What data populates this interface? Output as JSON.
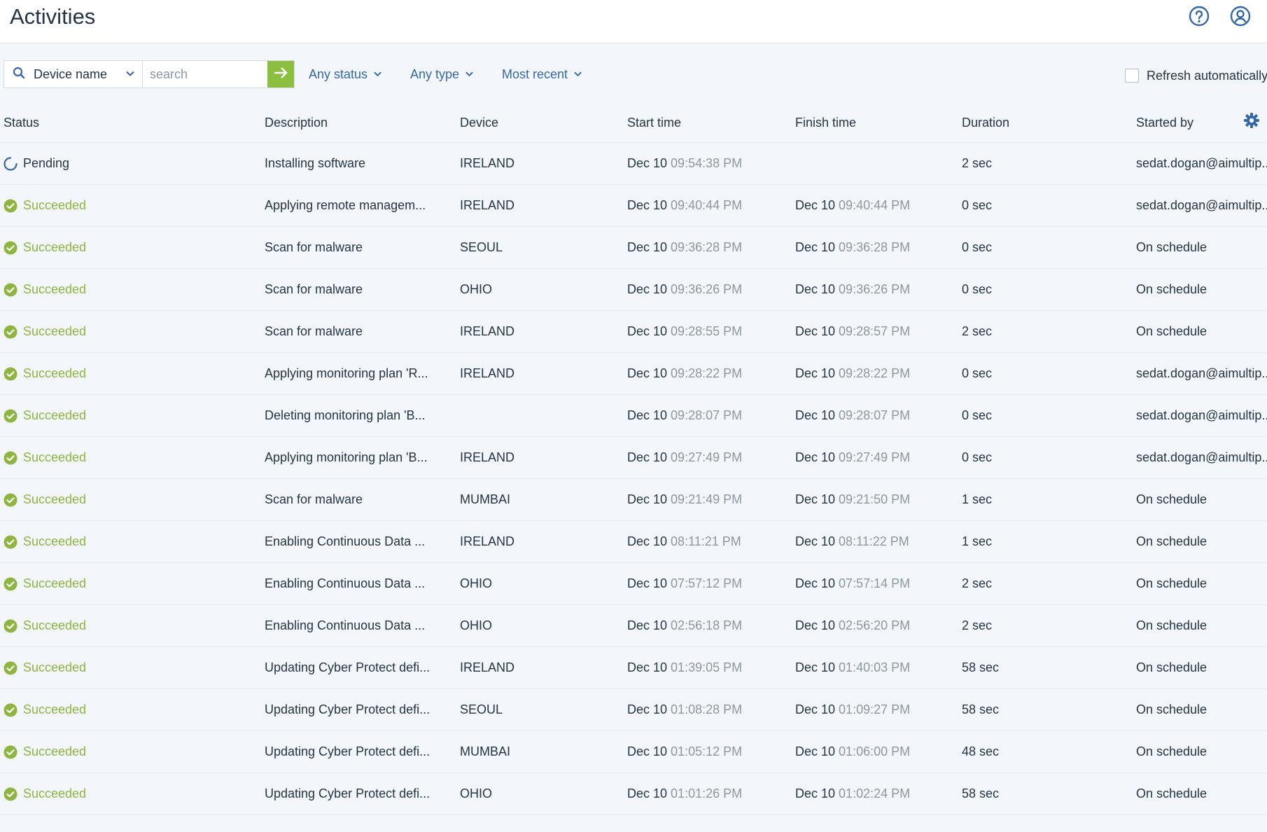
{
  "header": {
    "title": "Activities"
  },
  "toolbar": {
    "field_select_label": "Device name",
    "search_placeholder": "search",
    "status_filter": "Any status",
    "type_filter": "Any type",
    "sort_filter": "Most recent",
    "refresh_label": "Refresh automatically"
  },
  "columns": {
    "status": "Status",
    "description": "Description",
    "device": "Device",
    "start": "Start time",
    "finish": "Finish time",
    "duration": "Duration",
    "started_by": "Started by"
  },
  "colors": {
    "accent": "#3467a8",
    "success": "#8db53f",
    "go_button": "#8cbf3f"
  },
  "rows": [
    {
      "status": "Pending",
      "status_type": "pending",
      "description": "Installing software",
      "device": "IRELAND",
      "start_date": "Dec 10",
      "start_time": "09:54:38 PM",
      "finish_date": "",
      "finish_time": "",
      "duration": "2 sec",
      "started_by": "sedat.dogan@aimultip..."
    },
    {
      "status": "Succeeded",
      "status_type": "success",
      "description": "Applying remote managem...",
      "device": "IRELAND",
      "start_date": "Dec 10",
      "start_time": "09:40:44 PM",
      "finish_date": "Dec 10",
      "finish_time": "09:40:44 PM",
      "duration": "0 sec",
      "started_by": "sedat.dogan@aimultip..."
    },
    {
      "status": "Succeeded",
      "status_type": "success",
      "description": "Scan for malware",
      "device": "SEOUL",
      "start_date": "Dec 10",
      "start_time": "09:36:28 PM",
      "finish_date": "Dec 10",
      "finish_time": "09:36:28 PM",
      "duration": "0 sec",
      "started_by": "On schedule"
    },
    {
      "status": "Succeeded",
      "status_type": "success",
      "description": "Scan for malware",
      "device": "OHIO",
      "start_date": "Dec 10",
      "start_time": "09:36:26 PM",
      "finish_date": "Dec 10",
      "finish_time": "09:36:26 PM",
      "duration": "0 sec",
      "started_by": "On schedule"
    },
    {
      "status": "Succeeded",
      "status_type": "success",
      "description": "Scan for malware",
      "device": "IRELAND",
      "start_date": "Dec 10",
      "start_time": "09:28:55 PM",
      "finish_date": "Dec 10",
      "finish_time": "09:28:57 PM",
      "duration": "2 sec",
      "started_by": "On schedule"
    },
    {
      "status": "Succeeded",
      "status_type": "success",
      "description": "Applying monitoring plan 'R...",
      "device": "IRELAND",
      "start_date": "Dec 10",
      "start_time": "09:28:22 PM",
      "finish_date": "Dec 10",
      "finish_time": "09:28:22 PM",
      "duration": "0 sec",
      "started_by": "sedat.dogan@aimultip..."
    },
    {
      "status": "Succeeded",
      "status_type": "success",
      "description": "Deleting monitoring plan 'B...",
      "device": "",
      "start_date": "Dec 10",
      "start_time": "09:28:07 PM",
      "finish_date": "Dec 10",
      "finish_time": "09:28:07 PM",
      "duration": "0 sec",
      "started_by": "sedat.dogan@aimultip..."
    },
    {
      "status": "Succeeded",
      "status_type": "success",
      "description": "Applying monitoring plan 'B...",
      "device": "IRELAND",
      "start_date": "Dec 10",
      "start_time": "09:27:49 PM",
      "finish_date": "Dec 10",
      "finish_time": "09:27:49 PM",
      "duration": "0 sec",
      "started_by": "sedat.dogan@aimultip..."
    },
    {
      "status": "Succeeded",
      "status_type": "success",
      "description": "Scan for malware",
      "device": "MUMBAI",
      "start_date": "Dec 10",
      "start_time": "09:21:49 PM",
      "finish_date": "Dec 10",
      "finish_time": "09:21:50 PM",
      "duration": "1 sec",
      "started_by": "On schedule"
    },
    {
      "status": "Succeeded",
      "status_type": "success",
      "description": "Enabling Continuous Data ...",
      "device": "IRELAND",
      "start_date": "Dec 10",
      "start_time": "08:11:21 PM",
      "finish_date": "Dec 10",
      "finish_time": "08:11:22 PM",
      "duration": "1 sec",
      "started_by": "On schedule"
    },
    {
      "status": "Succeeded",
      "status_type": "success",
      "description": "Enabling Continuous Data ...",
      "device": "OHIO",
      "start_date": "Dec 10",
      "start_time": "07:57:12 PM",
      "finish_date": "Dec 10",
      "finish_time": "07:57:14 PM",
      "duration": "2 sec",
      "started_by": "On schedule"
    },
    {
      "status": "Succeeded",
      "status_type": "success",
      "description": "Enabling Continuous Data ...",
      "device": "OHIO",
      "start_date": "Dec 10",
      "start_time": "02:56:18 PM",
      "finish_date": "Dec 10",
      "finish_time": "02:56:20 PM",
      "duration": "2 sec",
      "started_by": "On schedule"
    },
    {
      "status": "Succeeded",
      "status_type": "success",
      "description": "Updating Cyber Protect defi...",
      "device": "IRELAND",
      "start_date": "Dec 10",
      "start_time": "01:39:05 PM",
      "finish_date": "Dec 10",
      "finish_time": "01:40:03 PM",
      "duration": "58 sec",
      "started_by": "On schedule"
    },
    {
      "status": "Succeeded",
      "status_type": "success",
      "description": "Updating Cyber Protect defi...",
      "device": "SEOUL",
      "start_date": "Dec 10",
      "start_time": "01:08:28 PM",
      "finish_date": "Dec 10",
      "finish_time": "01:09:27 PM",
      "duration": "58 sec",
      "started_by": "On schedule"
    },
    {
      "status": "Succeeded",
      "status_type": "success",
      "description": "Updating Cyber Protect defi...",
      "device": "MUMBAI",
      "start_date": "Dec 10",
      "start_time": "01:05:12 PM",
      "finish_date": "Dec 10",
      "finish_time": "01:06:00 PM",
      "duration": "48 sec",
      "started_by": "On schedule"
    },
    {
      "status": "Succeeded",
      "status_type": "success",
      "description": "Updating Cyber Protect defi...",
      "device": "OHIO",
      "start_date": "Dec 10",
      "start_time": "01:01:26 PM",
      "finish_date": "Dec 10",
      "finish_time": "01:02:24 PM",
      "duration": "58 sec",
      "started_by": "On schedule"
    }
  ]
}
